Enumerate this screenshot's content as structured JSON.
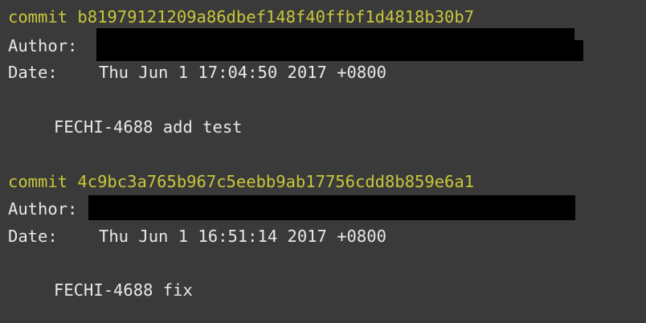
{
  "commits": [
    {
      "commit_keyword": "commit",
      "hash": "b81979121209a86dbef148f40ffbf1d4818b30b7",
      "author_label": "Author:",
      "date_label": "Date:",
      "date": "Thu Jun 1 17:04:50 2017 +0800",
      "message": "FECHI-4688 add test"
    },
    {
      "commit_keyword": "commit",
      "hash": "4c9bc3a765b967c5eebb9ab17756cdd8b859e6a1",
      "author_label": "Author:",
      "date_label": "Date:",
      "date": "Thu Jun 1 16:51:14 2017 +0800",
      "message": "FECHI-4688 fix"
    }
  ],
  "colors": {
    "background": "#3a3a3a",
    "commit_hash": "#c8c73a",
    "text": "#e8e8e8",
    "redaction": "#000000"
  }
}
